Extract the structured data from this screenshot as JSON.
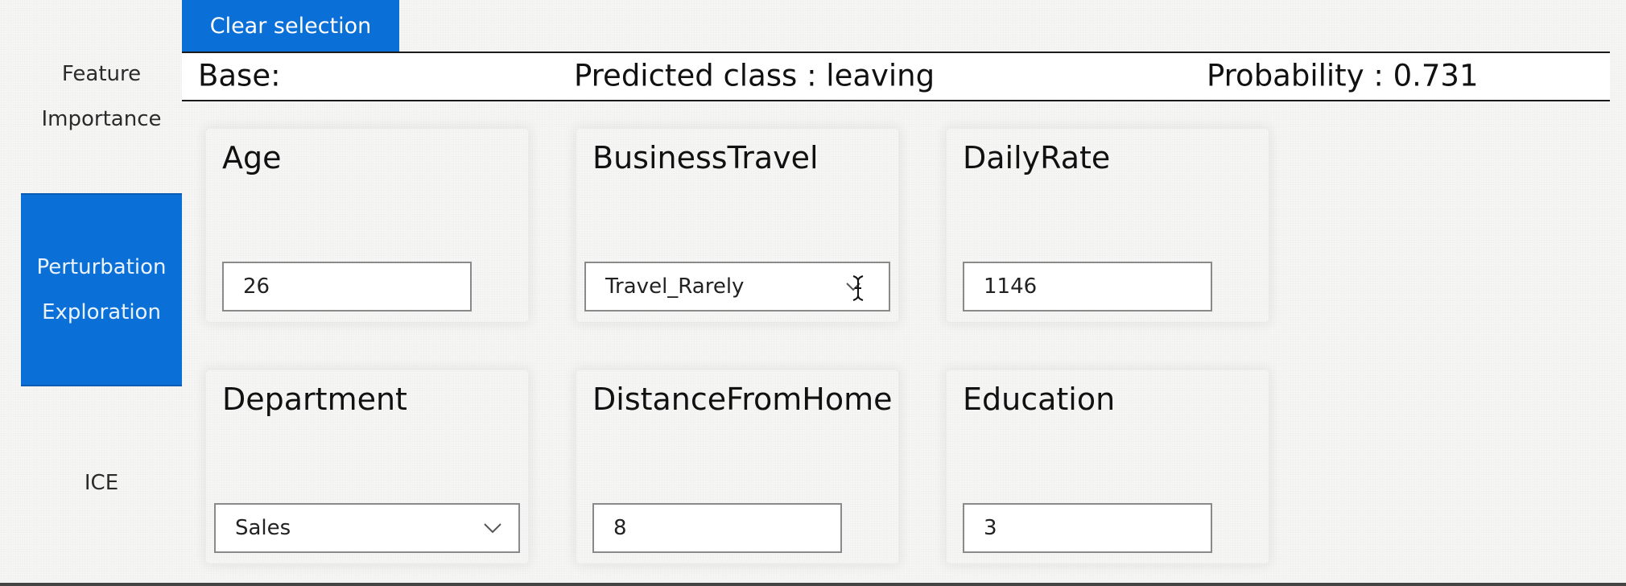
{
  "nav": {
    "items": [
      {
        "label_line1": "Feature",
        "label_line2": "Importance"
      },
      {
        "label_line1": "Perturbation",
        "label_line2": "Exploration"
      },
      {
        "label_line1": "ICE",
        "label_line2": ""
      }
    ],
    "active_index": 1
  },
  "toolbar": {
    "clear_label": "Clear selection"
  },
  "summary": {
    "base_label": "Base:",
    "predicted_class": "Predicted class : leaving",
    "probability": "Probability : 0.731"
  },
  "features": {
    "age": {
      "title": "Age",
      "value": "26"
    },
    "business_travel": {
      "title": "BusinessTravel",
      "value": "Travel_Rarely"
    },
    "daily_rate": {
      "title": "DailyRate",
      "value": "1146"
    },
    "department": {
      "title": "Department",
      "value": "Sales"
    },
    "distance_from_home": {
      "title": "DistanceFromHome",
      "value": "8"
    },
    "education": {
      "title": "Education",
      "value": "3"
    }
  },
  "icons": {
    "dropdown": "chevron-down-icon",
    "cursor": "text-cursor-icon"
  },
  "colors": {
    "accent": "#0a6fd6",
    "accent_text": "#ffffff",
    "rule": "#1a1a1a",
    "field_border": "#8a8a8a"
  }
}
